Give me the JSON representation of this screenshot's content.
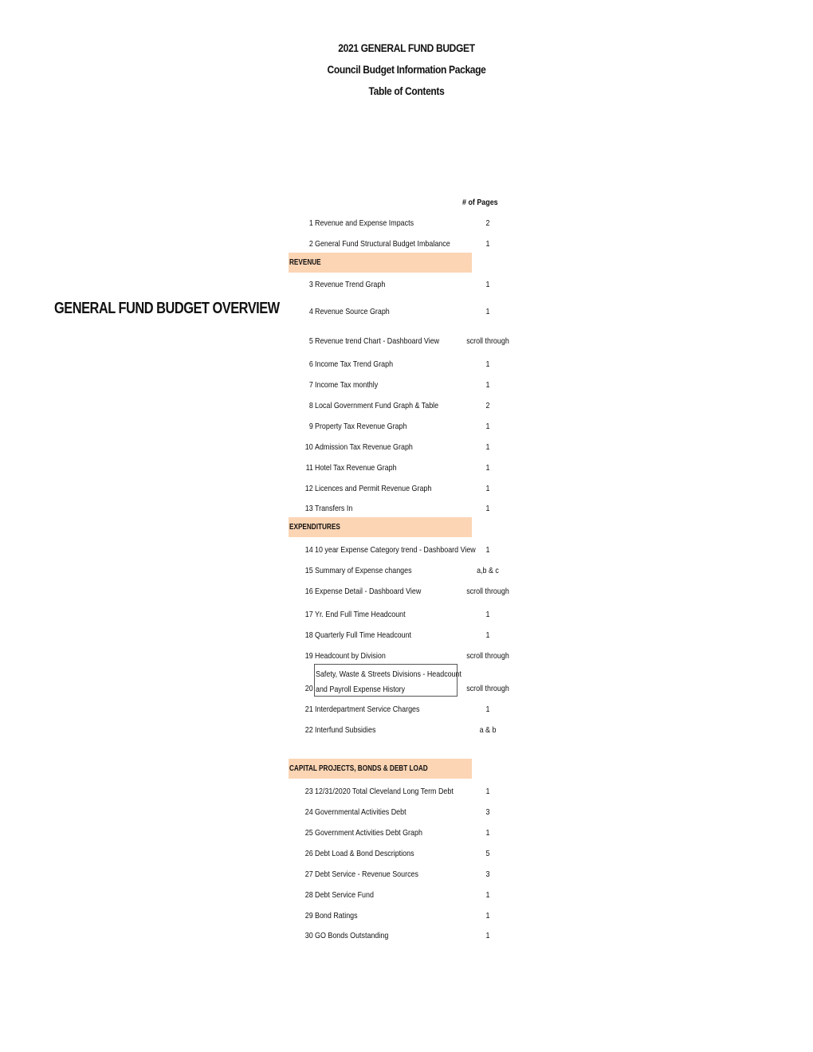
{
  "header": {
    "title": "2021 GENERAL FUND BUDGET",
    "subtitle": "Council Budget Information Package",
    "section_title": "Table of Contents"
  },
  "overview_label": "GENERAL FUND BUDGET OVERVIEW",
  "column_header": "# of Pages",
  "sections": {
    "revenue": "REVENUE",
    "expenditures": "EXPENDITURES",
    "capital": "CAPITAL PROJECTS, BONDS & DEBT LOAD"
  },
  "section_color": "#FCD5B4",
  "items": [
    {
      "num": "1",
      "label": "Revenue and Expense Impacts",
      "pages": "2"
    },
    {
      "num": "2",
      "label": "General Fund Structural Budget Imbalance",
      "pages": "1"
    },
    {
      "num": "3",
      "label": "Revenue Trend Graph",
      "pages": "1"
    },
    {
      "num": "4",
      "label": "Revenue Source Graph",
      "pages": "1"
    },
    {
      "num": "5",
      "label": "Revenue trend Chart - Dashboard View",
      "pages": "scroll through"
    },
    {
      "num": "6",
      "label": "Income Tax Trend Graph",
      "pages": "1"
    },
    {
      "num": "7",
      "label": "Income Tax monthly",
      "pages": "1"
    },
    {
      "num": "8",
      "label": "Local Government Fund Graph & Table",
      "pages": "2"
    },
    {
      "num": "9",
      "label": "Property Tax Revenue Graph",
      "pages": "1"
    },
    {
      "num": "10",
      "label": "Admission Tax Revenue Graph",
      "pages": "1"
    },
    {
      "num": "11",
      "label": "Hotel Tax Revenue Graph",
      "pages": "1"
    },
    {
      "num": "12",
      "label": "Licences and Permit Revenue Graph",
      "pages": "1"
    },
    {
      "num": "13",
      "label": "Transfers In",
      "pages": "1"
    },
    {
      "num": "14",
      "label": "10 year Expense Category trend - Dashboard View",
      "pages": "1"
    },
    {
      "num": "15",
      "label": "Summary of Expense changes",
      "pages": "a,b & c"
    },
    {
      "num": "16",
      "label": "Expense Detail - Dashboard View",
      "pages": "scroll through"
    },
    {
      "num": "17",
      "label": "Yr. End Full Time Headcount",
      "pages": "1"
    },
    {
      "num": "18",
      "label": "Quarterly Full Time Headcount",
      "pages": "1"
    },
    {
      "num": "19",
      "label": "Headcount by Division",
      "pages": "scroll through"
    },
    {
      "num": "20",
      "label_line1": "Safety, Waste & Streets Divisions - Headcount",
      "label_line2": "and Payroll Expense History",
      "pages": "scroll through"
    },
    {
      "num": "21",
      "label": "Interdepartment Service Charges",
      "pages": "1"
    },
    {
      "num": "22",
      "label": "Interfund Subsidies",
      "pages": "a & b"
    },
    {
      "num": "23",
      "label": "12/31/2020 Total Cleveland Long Term Debt",
      "pages": "1"
    },
    {
      "num": "24",
      "label": "Governmental Activities Debt",
      "pages": "3"
    },
    {
      "num": "25",
      "label": "Government Activities Debt Graph",
      "pages": "1"
    },
    {
      "num": "26",
      "label": "Debt Load & Bond Descriptions",
      "pages": "5"
    },
    {
      "num": "27",
      "label": "Debt Service - Revenue Sources",
      "pages": "3"
    },
    {
      "num": "28",
      "label": "Debt Service Fund",
      "pages": "1"
    },
    {
      "num": "29",
      "label": "Bond Ratings",
      "pages": "1"
    },
    {
      "num": "30",
      "label": "GO Bonds Outstanding",
      "pages": "1"
    }
  ]
}
